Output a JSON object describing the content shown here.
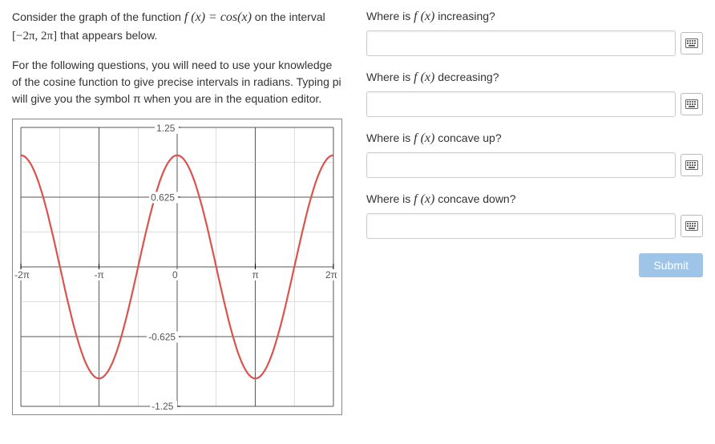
{
  "left": {
    "intro1_a": "Consider the graph of the function ",
    "intro1_fx": "f (x) = cos(x)",
    "intro1_b": " on the interval ",
    "interval": "[−2π, 2π]",
    "intro1_c": " that appears below.",
    "intro2": "For the following questions, you will need to use your knowledge of the cosine function to give precise intervals in radians.  Typing pi will give you the symbol π when you are in the equation editor."
  },
  "graph": {
    "x_ticks": [
      "-2π",
      "-π",
      "0",
      "π",
      "2π"
    ],
    "y_ticks": [
      "1.25",
      "0.625",
      "0",
      "-0.625",
      "-1.25"
    ]
  },
  "questions": {
    "q1": {
      "prefix": "Where is ",
      "fx": "f (x)",
      "suffix": "  increasing?"
    },
    "q2": {
      "prefix": "Where is ",
      "fx": "f (x)",
      "suffix": "  decreasing?"
    },
    "q3": {
      "prefix": "Where is ",
      "fx": "f (x)",
      "suffix": "  concave up?"
    },
    "q4": {
      "prefix": "Where is ",
      "fx": "f (x)",
      "suffix": "  concave down?"
    }
  },
  "submit_label": "Submit"
}
